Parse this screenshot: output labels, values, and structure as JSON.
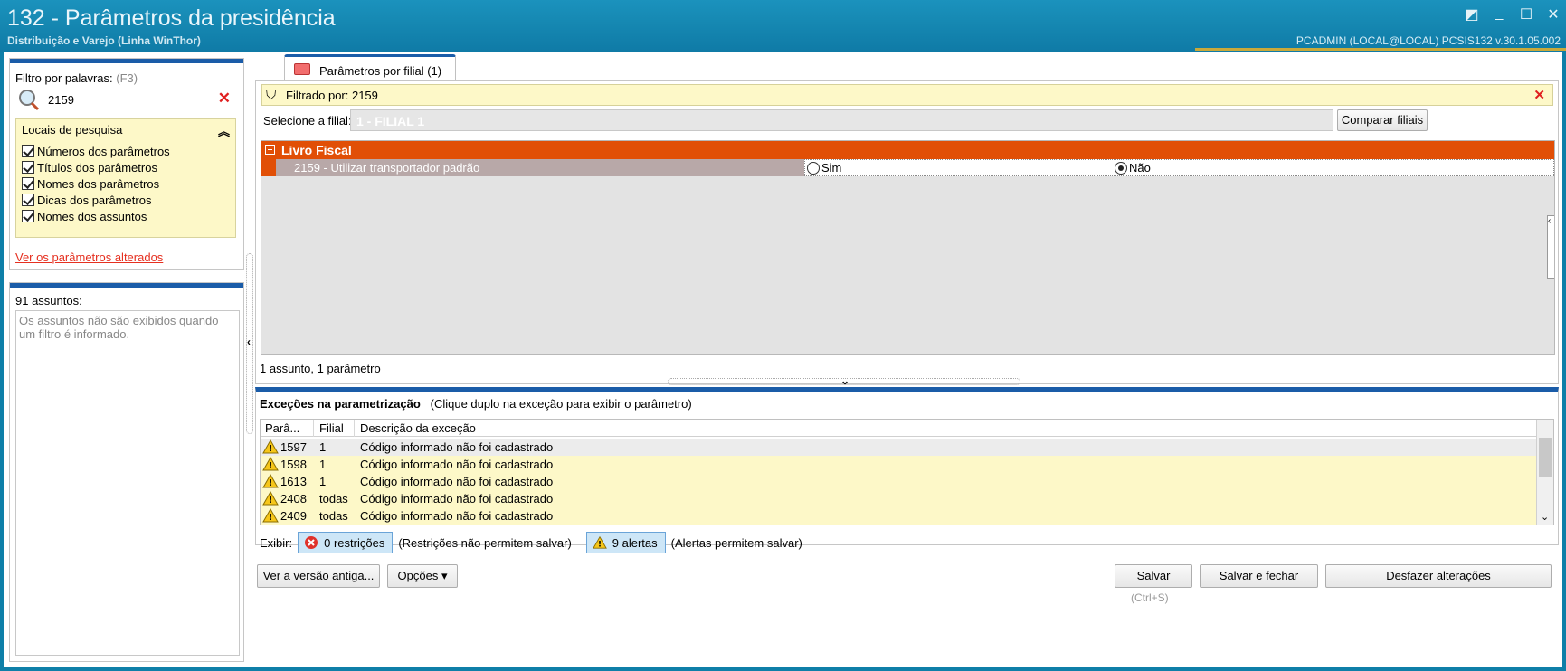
{
  "window": {
    "title": "132 - Parâmetros da presidência",
    "subtitle": "Distribuição e Varejo (Linha WinThor)",
    "user_info": "PCADMIN (LOCAL@LOCAL)   PCSIS132  v.30.1.05.002"
  },
  "filter": {
    "label": "Filtro por palavras:",
    "shortcut": "(F3)",
    "value": "2159",
    "locals_title": "Locais de pesquisa",
    "options": [
      {
        "label": "Números dos parâmetros",
        "checked": true
      },
      {
        "label": "Títulos dos parâmetros",
        "checked": true
      },
      {
        "label": "Nomes dos parâmetros",
        "checked": true
      },
      {
        "label": "Dicas dos parâmetros",
        "checked": true
      },
      {
        "label": "Nomes dos assuntos",
        "checked": true
      }
    ],
    "altered_link": "Ver os parâmetros alterados"
  },
  "subjects": {
    "count_label": "91 assuntos:",
    "message": "Os assuntos não são exibidos quando um filtro é informado."
  },
  "tab": {
    "label": "Parâmetros por filial  (1)"
  },
  "filter_bar": {
    "text": "Filtrado por: 2159"
  },
  "filial": {
    "label": "Selecione a filial:",
    "value": "1 - FILIAL 1",
    "compare_button": "Comparar filiais"
  },
  "grid": {
    "group": "Livro Fiscal",
    "param_label": "2159 - Utilizar transportador padrão",
    "option_yes": "Sim",
    "option_no": "Não",
    "selected": "Não",
    "footer": "1 assunto, 1 parâmetro"
  },
  "exceptions": {
    "title": "Exceções na parametrização",
    "hint": "(Clique duplo na exceção para exibir o parâmetro)",
    "columns": [
      "Parâ...",
      "Filial",
      "Descrição da exceção"
    ],
    "rows": [
      {
        "param": "1597",
        "filial": "1",
        "desc": "Código informado não foi cadastrado"
      },
      {
        "param": "1598",
        "filial": "1",
        "desc": "Código informado não foi cadastrado"
      },
      {
        "param": "1613",
        "filial": "1",
        "desc": "Código informado não foi cadastrado"
      },
      {
        "param": "2408",
        "filial": "todas",
        "desc": "Código informado não foi cadastrado"
      },
      {
        "param": "2409",
        "filial": "todas",
        "desc": "Código informado não foi cadastrado"
      }
    ],
    "show_label": "Exibir:",
    "restrictions_btn": "0 restrições",
    "restrictions_note": "(Restrições não permitem salvar)",
    "alerts_btn": "9 alertas",
    "alerts_note": "(Alertas permitem salvar)"
  },
  "buttons": {
    "old_version": "Ver a versão antiga...",
    "options": "Opções",
    "save": "Salvar",
    "save_shortcut": "(Ctrl+S)",
    "save_close": "Salvar e fechar",
    "undo": "Desfazer alterações"
  }
}
